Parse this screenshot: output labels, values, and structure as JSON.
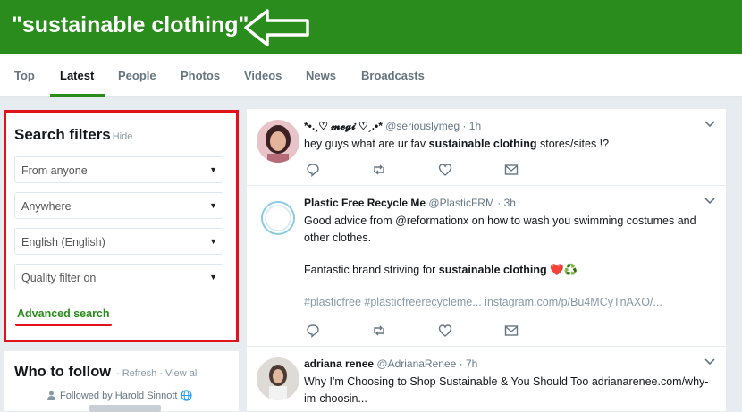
{
  "header": {
    "title": "\"sustainable clothing\""
  },
  "tabs": [
    {
      "label": "Top"
    },
    {
      "label": "Latest"
    },
    {
      "label": "People"
    },
    {
      "label": "Photos"
    },
    {
      "label": "Videos"
    },
    {
      "label": "News"
    },
    {
      "label": "Broadcasts"
    }
  ],
  "active_tab": "Latest",
  "filters": {
    "title": "Search filters",
    "hide_label": "· Hide",
    "selects": [
      {
        "value": "From anyone"
      },
      {
        "value": "Anywhere"
      },
      {
        "value": "English (English)"
      },
      {
        "value": "Quality filter on"
      }
    ],
    "advanced_label": "Advanced search"
  },
  "who_to_follow": {
    "title": "Who to follow",
    "refresh": "· Refresh",
    "view_all": "· View all",
    "followed_by": "Followed by Harold Sinnott"
  },
  "tweets": [
    {
      "name": "*•.¸♡ 𝓶𝓮𝓰𝓲 ♡¸.•*",
      "handle": "@seriouslymeg",
      "time": "· 1h",
      "text_pre": "hey guys what are ur fav ",
      "text_bold": "sustainable clothing",
      "text_post": " stores/sites !?"
    },
    {
      "name": "Plastic Free Recycle Me",
      "handle": "@PlasticFRM",
      "time": "· 3h",
      "line1": "Good advice from @reformationx on how to wash you swimming costumes and",
      "line2": "other clothes.",
      "line3_pre": "Fantastic brand striving for ",
      "line3_bold": "sustainable clothing",
      "line3_emoji": "❤️♻️",
      "line4": "#plasticfree #plasticfreerecycleme... instagram.com/p/Bu4MCyTnAXO/..."
    },
    {
      "name": "adriana renee",
      "handle": "@AdrianaRenee",
      "time": "· 7h",
      "line1": "Why I'm Choosing to Shop Sustainable & You Should Too adrianarenee.com/why-",
      "line2": "im-choosin..."
    }
  ],
  "colors": {
    "brand": "#2a8c1c",
    "highlight": "#e0131a",
    "background": "#e6ecf0"
  }
}
